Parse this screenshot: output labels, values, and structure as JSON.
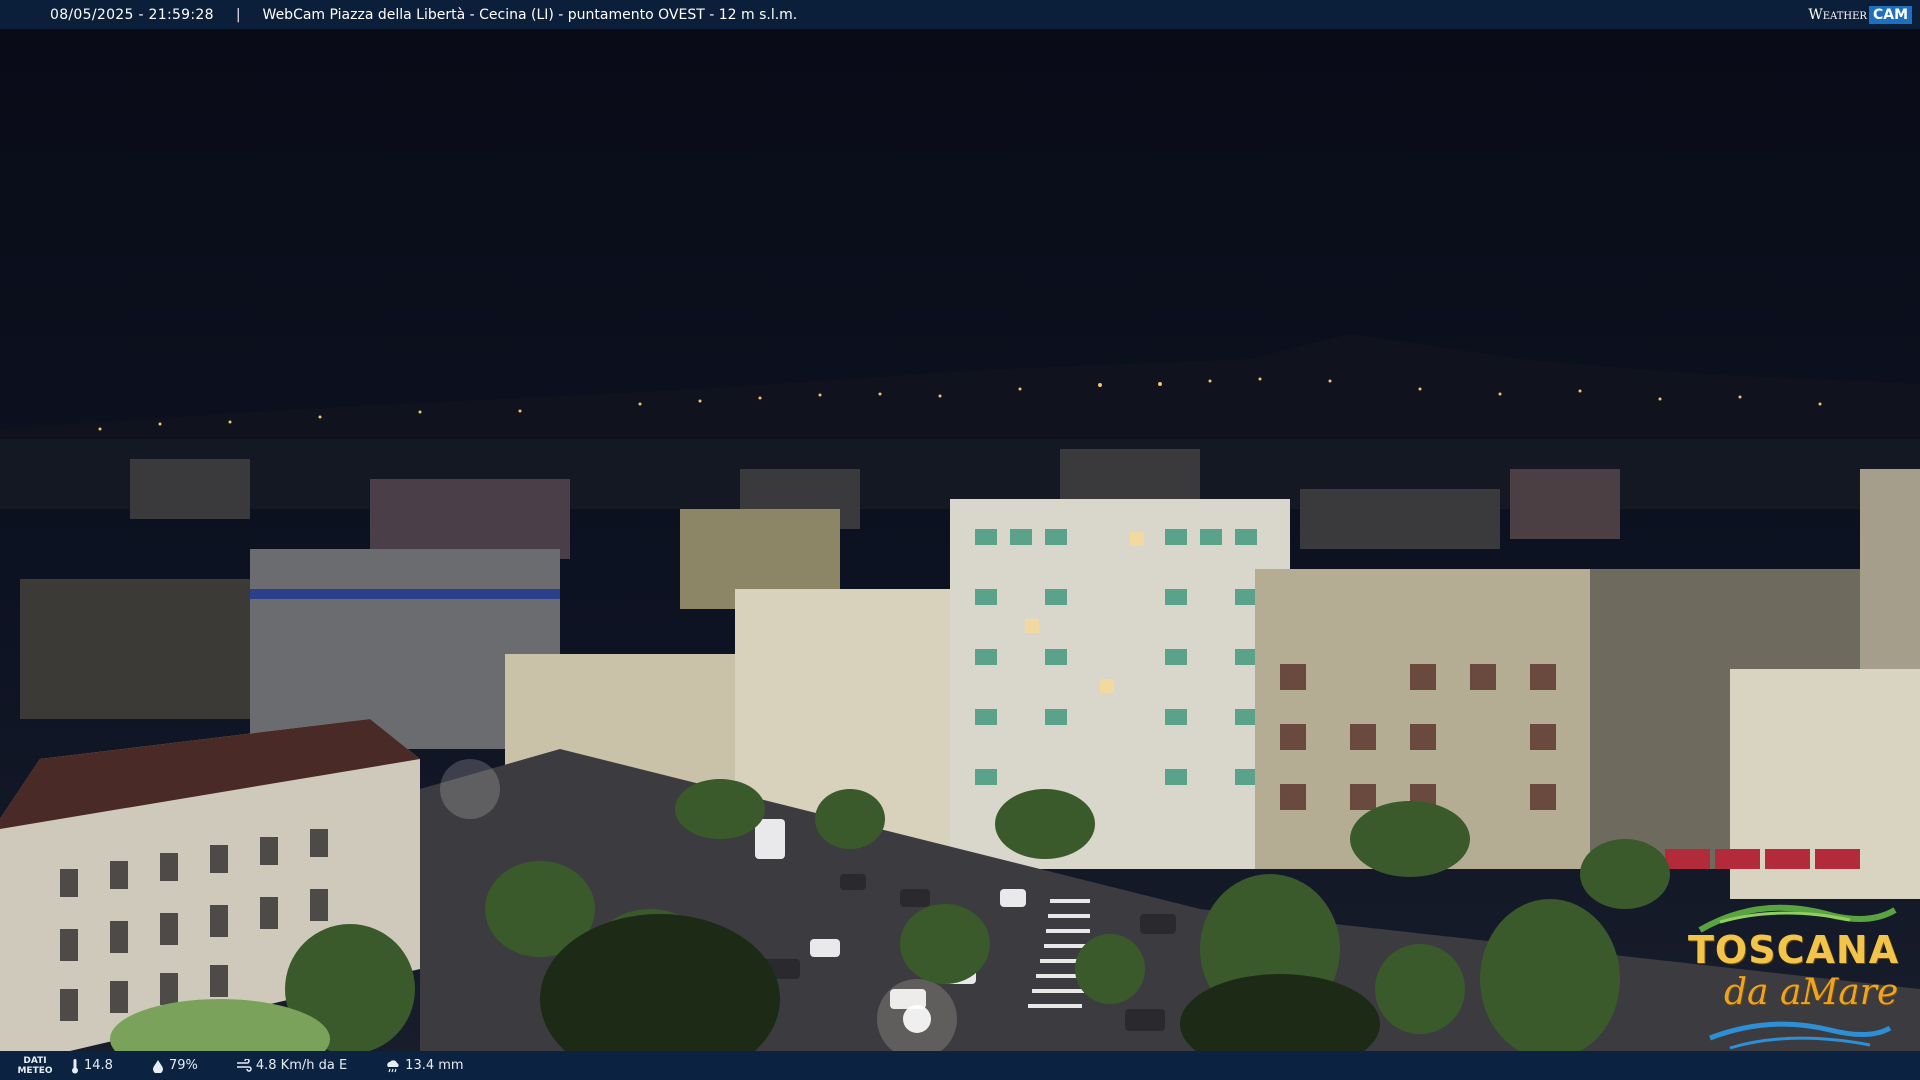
{
  "overlay": {
    "datetime": "08/05/2025 - 21:59:28",
    "separator": "|",
    "caption": "WebCam Piazza della Libertà - Cecina (LI) - puntamento OVEST - 12 m s.l.m.",
    "brand_word": "Weather",
    "brand_cam": "CAM"
  },
  "weather_bar": {
    "label_line1": "DATI",
    "label_line2": "METEO",
    "temperature": "14.8",
    "humidity": "79%",
    "wind": "4.8 Km/h da E",
    "rain": "13.4 mm"
  },
  "logo": {
    "line1": "TOSCANA",
    "line2": "da aMare"
  },
  "colors": {
    "top_bar": "#0c1f3a",
    "bottom_bar": "#0b2340",
    "brand_accent": "#1e6fc0",
    "logo_gold": "#f2c44a"
  }
}
